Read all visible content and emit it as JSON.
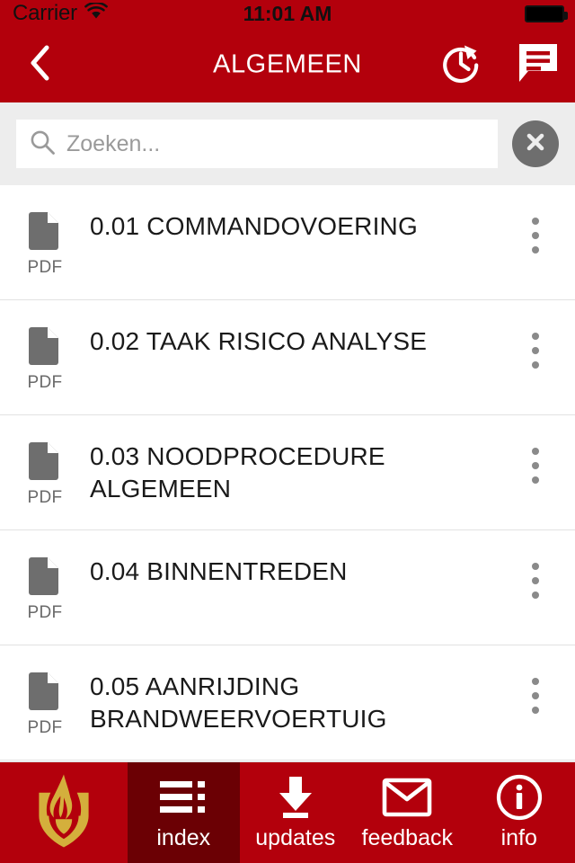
{
  "status_bar": {
    "carrier": "Carrier",
    "wifi_icon": "wifi-icon",
    "time": "11:01 AM",
    "battery_icon": "battery-full-icon"
  },
  "nav": {
    "back_icon": "chevron-left-icon",
    "title": "ALGEMEEN",
    "actions": [
      {
        "name": "history-refresh-icon",
        "label": "history"
      },
      {
        "name": "comments-icon",
        "label": "comments"
      }
    ]
  },
  "search": {
    "icon": "search-icon",
    "value": "",
    "placeholder": "Zoeken...",
    "clear_icon": "close-circle-icon"
  },
  "list": {
    "rows": [
      {
        "title": "0.01 COMMANDOVOERING",
        "filetype": "PDF",
        "icon": "pdf-file-icon",
        "menu_icon": "more-vertical-icon"
      },
      {
        "title": "0.02 TAAK RISICO ANALYSE",
        "filetype": "PDF",
        "icon": "pdf-file-icon",
        "menu_icon": "more-vertical-icon"
      },
      {
        "title": "0.03 NOODPROCEDURE ALGEMEEN",
        "filetype": "PDF",
        "icon": "pdf-file-icon",
        "menu_icon": "more-vertical-icon"
      },
      {
        "title": "0.04 BINNENTREDEN",
        "filetype": "PDF",
        "icon": "pdf-file-icon",
        "menu_icon": "more-vertical-icon"
      },
      {
        "title": "0.05 AANRIJDING BRANDWEERVOERTUIG",
        "filetype": "PDF",
        "icon": "pdf-file-icon",
        "menu_icon": "more-vertical-icon"
      }
    ]
  },
  "tabbar": {
    "logo": {
      "name": "brandweer-flame-logo",
      "label": ""
    },
    "tabs": [
      {
        "label": "index",
        "icon": "list-index-icon",
        "active": true
      },
      {
        "label": "updates",
        "icon": "download-icon",
        "active": false
      },
      {
        "label": "feedback",
        "icon": "envelope-icon",
        "active": false
      },
      {
        "label": "info",
        "icon": "info-circle-icon",
        "active": false
      }
    ]
  },
  "colors": {
    "brand_red": "#B3000C",
    "active_tab_red": "#6B0004",
    "logo_gold": "#D4AF3C",
    "search_bg": "#EDEDED",
    "icon_gray": "#6E6E6E",
    "text_dark": "#1A1A1A"
  }
}
